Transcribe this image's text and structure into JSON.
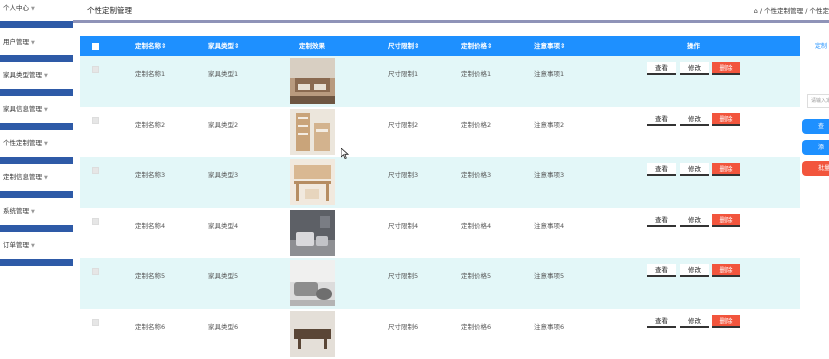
{
  "sidebar": {
    "items": [
      {
        "label": "个人中心"
      },
      {
        "label": "用户管理"
      },
      {
        "label": "家具类型管理"
      },
      {
        "label": "家具信息管理"
      },
      {
        "label": "个性定制管理"
      },
      {
        "label": "定制信息管理"
      },
      {
        "label": "系统管理"
      },
      {
        "label": "订单管理"
      }
    ],
    "accent_color": "#2e5aa7"
  },
  "header": {
    "title": "个性定制管理",
    "breadcrumb": "/ 个性定制管理 / 个性定",
    "home_icon": "home-icon"
  },
  "table": {
    "columns": [
      "定制名称",
      "家具类型",
      "定制效果",
      "尺寸限制",
      "定制价格",
      "注意事项",
      "操作"
    ],
    "header_color": "#1e90ff",
    "alt_row_color": "#e3f7f8",
    "rows": [
      {
        "name": "定制名称1",
        "type": "家具类型1",
        "size": "尺寸限制1",
        "price": "定制价格1",
        "note": "注意事项1"
      },
      {
        "name": "定制名称2",
        "type": "家具类型2",
        "size": "尺寸限制2",
        "price": "定制价格2",
        "note": "注意事项2"
      },
      {
        "name": "定制名称3",
        "type": "家具类型3",
        "size": "尺寸限制3",
        "price": "定制价格3",
        "note": "注意事项3"
      },
      {
        "name": "定制名称4",
        "type": "家具类型4",
        "size": "尺寸限制4",
        "price": "定制价格4",
        "note": "注意事项4"
      },
      {
        "name": "定制名称5",
        "type": "家具类型5",
        "size": "尺寸限制5",
        "price": "定制价格5",
        "note": "注意事项5"
      },
      {
        "name": "定制名称6",
        "type": "家具类型6",
        "size": "尺寸限制6",
        "price": "定制价格6",
        "note": "注意事项6"
      }
    ],
    "actions": {
      "view": "查看",
      "edit": "修改",
      "delete": "删除"
    },
    "delete_color": "#f2553d"
  },
  "right_panel": {
    "label": "定制",
    "search_placeholder": "请输入定",
    "buttons": [
      {
        "label": "查",
        "color": "#1e90ff"
      },
      {
        "label": "添",
        "color": "#1e90ff"
      },
      {
        "label": "批量",
        "color": "#f2553d"
      }
    ]
  }
}
